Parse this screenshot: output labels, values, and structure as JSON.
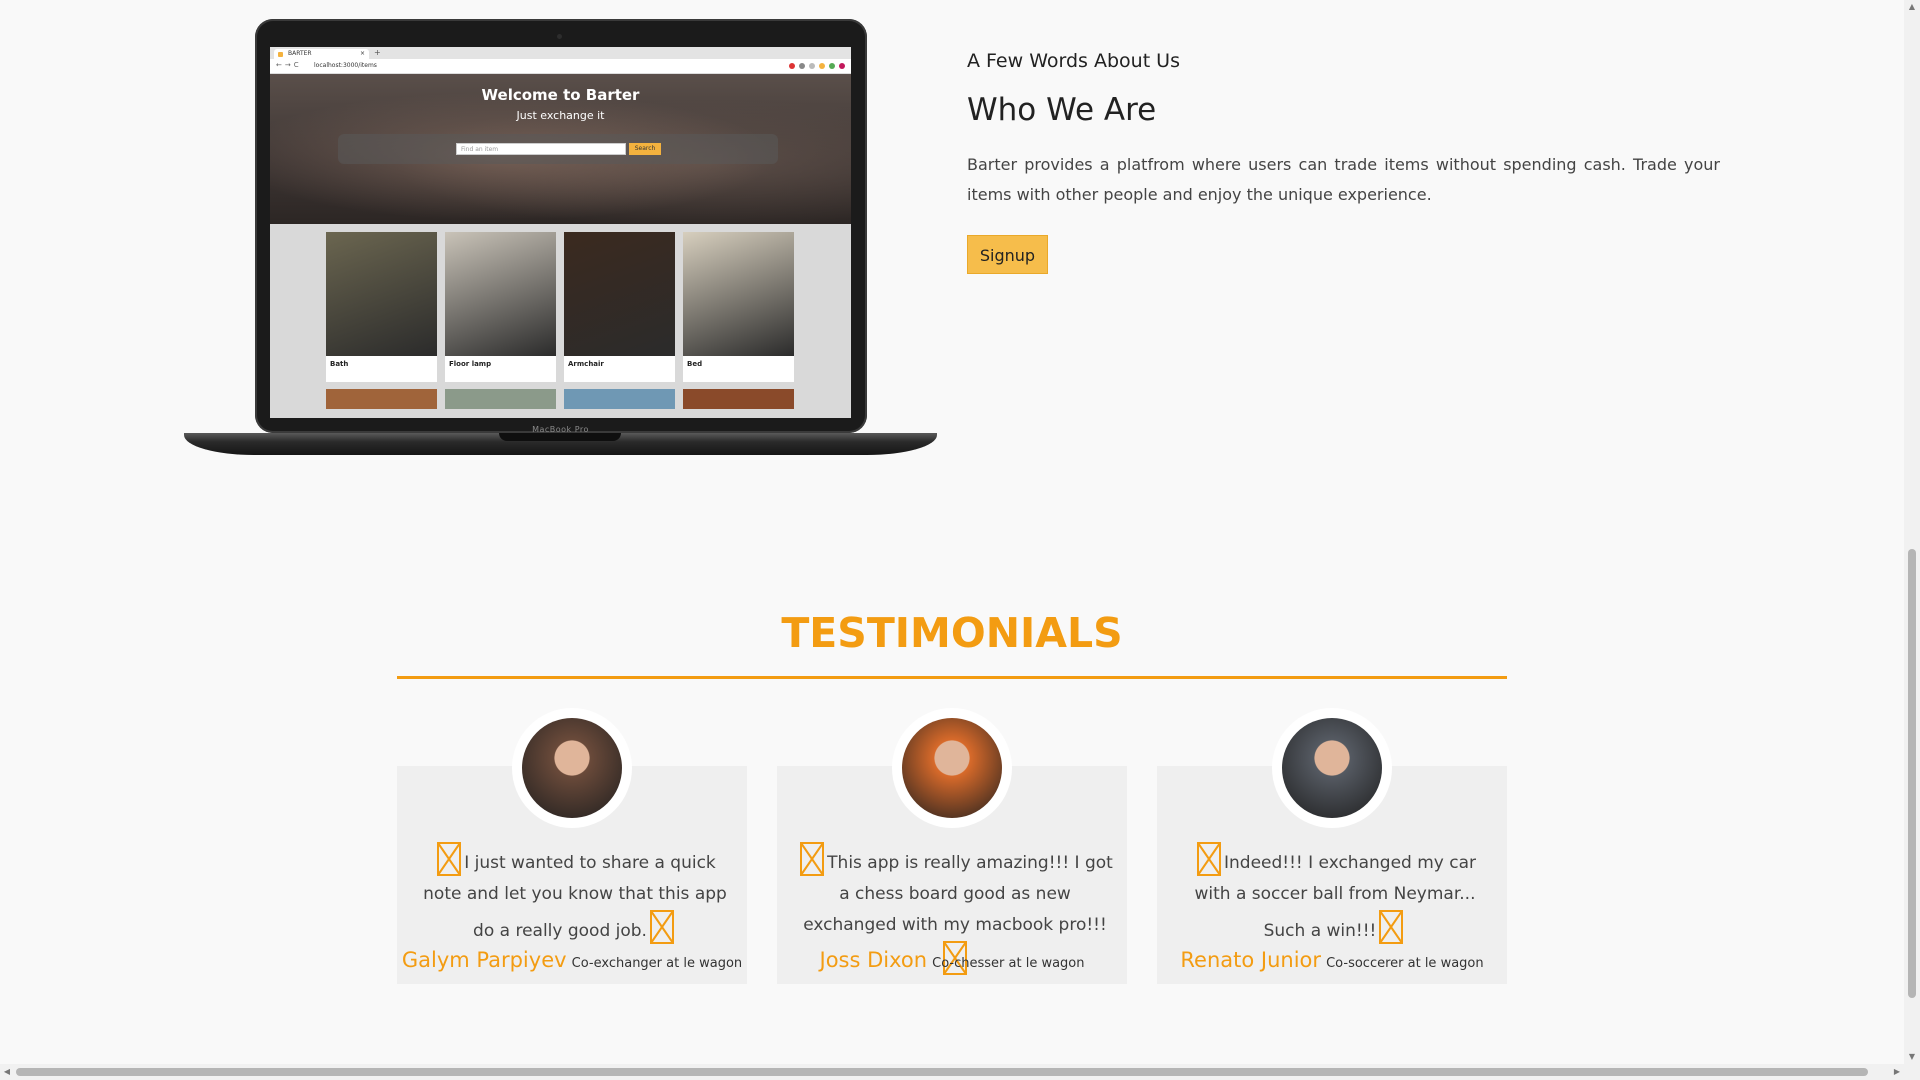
{
  "laptop": {
    "brand": "MacBook Pro",
    "browser": {
      "tab_title": "BARTER",
      "tab_close": "×",
      "new_tab": "+",
      "nav": "←→C",
      "url": "localhost:3000/items"
    },
    "hero": {
      "title": "Welcome to Barter",
      "subtitle": "Just exchange it",
      "search_placeholder": "Find an item",
      "search_button": "Search"
    },
    "items": [
      {
        "label": "Bath",
        "tone": "#6b6650"
      },
      {
        "label": "Floor lamp",
        "tone": "#c9c3b8"
      },
      {
        "label": "Armchair",
        "tone": "#3b2a1f"
      },
      {
        "label": "Bed",
        "tone": "#d7cfbe"
      }
    ]
  },
  "about": {
    "kicker": "A Few Words About Us",
    "title": "Who We Are",
    "text": "Barter provides a platfrom where users can trade items without spending cash. Trade your items with other people and enjoy the unique experience.",
    "button": "Signup"
  },
  "testimonials": {
    "heading": "TESTIMONIALS",
    "items": [
      {
        "quote": "I just wanted to share a quick note and let you know that this app do a really good job.",
        "name": "Galym Parpiyev",
        "role": "Co-exchanger at le wagon",
        "avatar_tone": "#6a4a3a"
      },
      {
        "quote": "This app is really amazing!!! I got a chess board good as new exchanged with my macbook pro!!!",
        "name": "Joss Dixon",
        "role": "Co-chesser at le wagon",
        "avatar_tone": "#d86a2a"
      },
      {
        "quote": "Indeed!!! I exchanged my car with a soccer ball from Neymar... Such a win!!!",
        "name": "Renato Junior",
        "role": "Co-soccerer at le wagon",
        "avatar_tone": "#555a62"
      }
    ]
  },
  "colors": {
    "accent": "#f39c12",
    "button": "#f6bd4b",
    "card_bg": "#efefef",
    "page_bg": "#f9f9f9"
  }
}
